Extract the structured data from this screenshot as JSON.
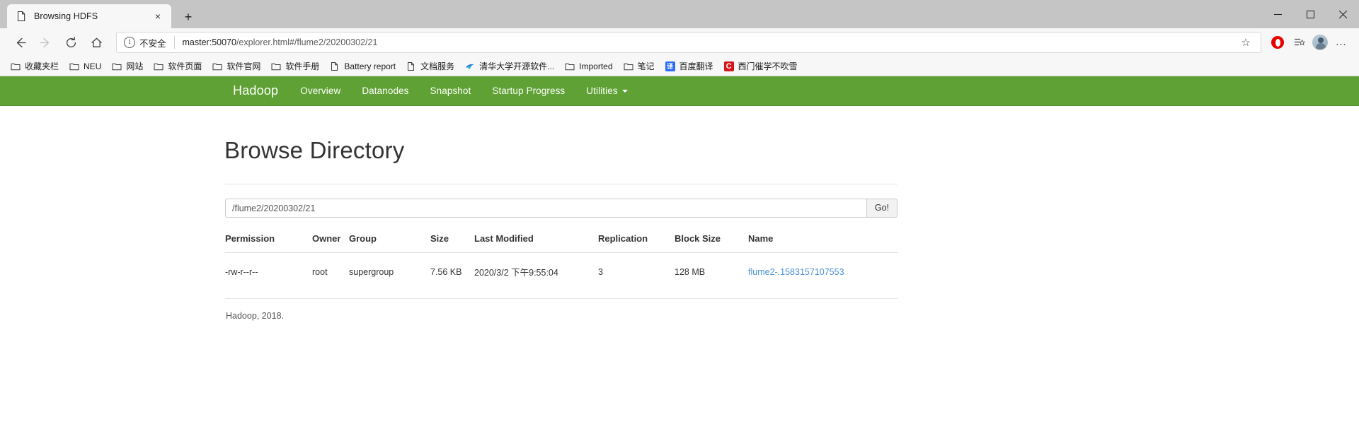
{
  "browser": {
    "tab": {
      "title": "Browsing HDFS",
      "favicon_icon": "page-icon",
      "close_icon": "×"
    },
    "newtab_icon": "+",
    "window_controls": {
      "minimize": "—",
      "maximize": "▢",
      "close": "✕"
    },
    "nav": {
      "back_icon": "←",
      "forward_icon": "→",
      "reload_icon": "⟳",
      "home_icon": "⌂"
    },
    "omnibox": {
      "security_label": "不安全",
      "url_host": "master:50070",
      "url_path": "/explorer.html#/flume2/20200302/21",
      "favorite_icon": "☆",
      "opera_icon": "opera-icon",
      "collections_icon": "collections-icon",
      "profile_icon": "avatar",
      "settings_icon": "…"
    },
    "bookmarks": [
      {
        "label": "收藏夹栏",
        "icon": "folder-icon"
      },
      {
        "label": "NEU",
        "icon": "folder-icon"
      },
      {
        "label": "网站",
        "icon": "folder-icon"
      },
      {
        "label": "软件页面",
        "icon": "folder-icon"
      },
      {
        "label": "软件官网",
        "icon": "folder-icon"
      },
      {
        "label": "软件手册",
        "icon": "folder-icon"
      },
      {
        "label": "Battery report",
        "icon": "page-icon"
      },
      {
        "label": "文档服务",
        "icon": "page-icon"
      },
      {
        "label": "清华大学开源软件...",
        "icon": "tuna-icon"
      },
      {
        "label": "Imported",
        "icon": "folder-icon"
      },
      {
        "label": "笔记",
        "icon": "folder-icon"
      },
      {
        "label": "百度翻译",
        "icon": "baidu-icon",
        "icon_text": "译"
      },
      {
        "label": "西门催学不吹雪",
        "icon": "red-c-icon",
        "icon_text": "C"
      }
    ]
  },
  "hadoop": {
    "brand": "Hadoop",
    "nav_items": [
      {
        "label": "Overview",
        "dropdown": false
      },
      {
        "label": "Datanodes",
        "dropdown": false
      },
      {
        "label": "Snapshot",
        "dropdown": false
      },
      {
        "label": "Startup Progress",
        "dropdown": false
      },
      {
        "label": "Utilities",
        "dropdown": true
      }
    ],
    "nav_bg_color": "#5fa134",
    "page_title": "Browse Directory",
    "path_value": "/flume2/20200302/21",
    "go_label": "Go!",
    "table": {
      "columns": [
        "Permission",
        "Owner",
        "Group",
        "Size",
        "Last Modified",
        "Replication",
        "Block Size",
        "Name"
      ],
      "rows": [
        {
          "permission": "-rw-r--r--",
          "owner": "root",
          "group": "supergroup",
          "size": "7.56 KB",
          "last_modified": "2020/3/2 下午9:55:04",
          "replication": "3",
          "block_size": "128 MB",
          "name": "flume2-.1583157107553"
        }
      ]
    },
    "footer": "Hadoop, 2018.",
    "link_color": "#4b8fd1"
  }
}
